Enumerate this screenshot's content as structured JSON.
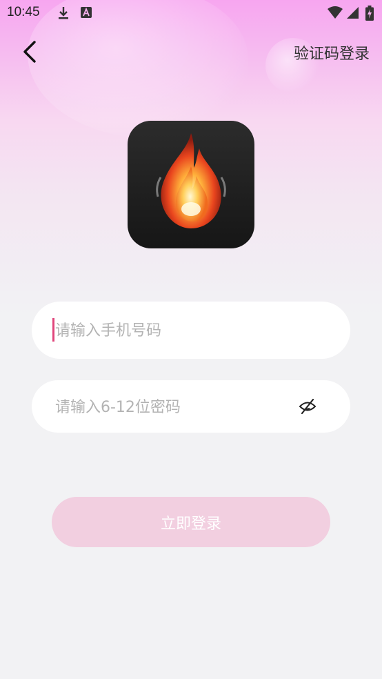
{
  "status_bar": {
    "time": "10:45",
    "icons": [
      "download-icon",
      "text-a-icon",
      "wifi-icon",
      "signal-icon",
      "battery-charging-icon"
    ]
  },
  "nav": {
    "back_icon": "chevron-left-icon",
    "sms_login_label": "验证码登录"
  },
  "logo": {
    "icon": "flame-drop-icon"
  },
  "form": {
    "phone_placeholder": "请输入手机号码",
    "phone_value": "",
    "password_placeholder": "请输入6-12位密码",
    "password_value": "",
    "visibility_icon": "eye-off-icon"
  },
  "submit": {
    "label": "立即登录"
  },
  "colors": {
    "accent": "#e0457b",
    "button_bg": "#f2cfe0",
    "page_bg": "#f2f2f4",
    "header_gradient_top": "#f7a6f0"
  }
}
